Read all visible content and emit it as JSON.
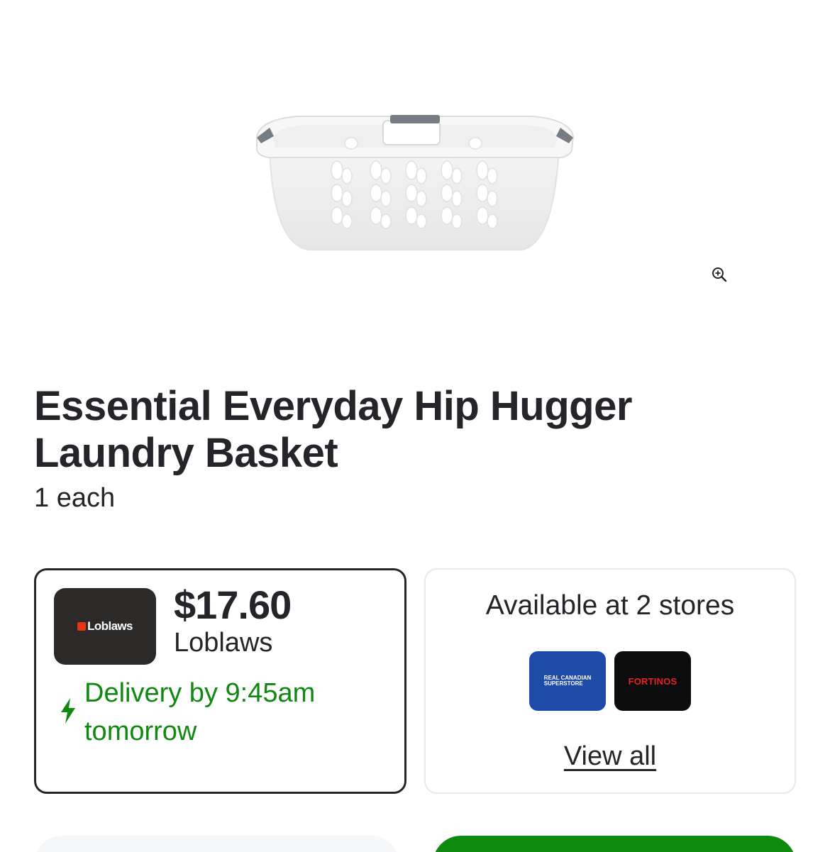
{
  "product": {
    "title": "Essential Everyday Hip Hugger Laundry Basket",
    "size": "1 each",
    "image_icon": "laundry-basket-image",
    "zoom_icon": "zoom-in-icon"
  },
  "retailer": {
    "price": "$17.60",
    "store_name": "Loblaws",
    "logo_text": "Loblaws",
    "delivery_text": "Delivery by 9:45am tomorrow",
    "delivery_icon": "lightning-icon",
    "delivery_color": "#108910"
  },
  "availability": {
    "title": "Available at 2 stores",
    "stores": [
      {
        "name": "REAL CANADIAN SUPERSTORE",
        "line1": "REAL CANADIAN",
        "line2": "SUPERSTORE",
        "color": "#1e4ba8"
      },
      {
        "name": "FORTINOS",
        "color": "#0c0c0c"
      }
    ],
    "view_all": "View all"
  },
  "colors": {
    "accent_green": "#0e8a0e",
    "text": "#242529"
  }
}
